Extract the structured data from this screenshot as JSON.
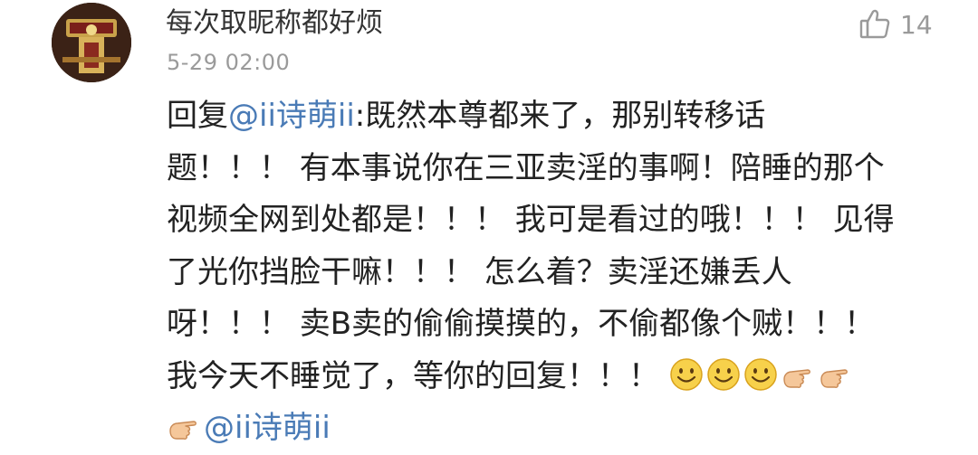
{
  "comment": {
    "username": "每次取昵称都好烦",
    "timestamp": "5-29 02:00",
    "like_count": "14",
    "lines": [
      {
        "prefix": "回复",
        "mention": "@ii诗萌ii",
        "text": ":既然本尊都来了，那别转移话"
      },
      {
        "text": "题！！！ 有本事说你在三亚卖淫的事啊！陪睡的那个"
      },
      {
        "text": "视频全网到处都是！！！ 我可是看过的哦！！！ 见得"
      },
      {
        "text": "了光你挡脸干嘛！！！ 怎么着？卖淫还嫌丢人"
      },
      {
        "text": "呀！！！ 卖B卖的偷偷摸摸的，不偷都像个贼！！！"
      },
      {
        "text": "我今天不睡觉了，等你的回复！！！"
      },
      {
        "mention": "@ii诗萌ii"
      }
    ],
    "trailing_emojis": [
      "smile",
      "smile",
      "smile",
      "thumbs-point-hand",
      "thumbs-point-hand"
    ],
    "last_line_emoji": "thumbs-point-hand"
  },
  "colors": {
    "mention": "#4a7bb6",
    "text": "#222222",
    "meta": "#9a9a9a"
  }
}
